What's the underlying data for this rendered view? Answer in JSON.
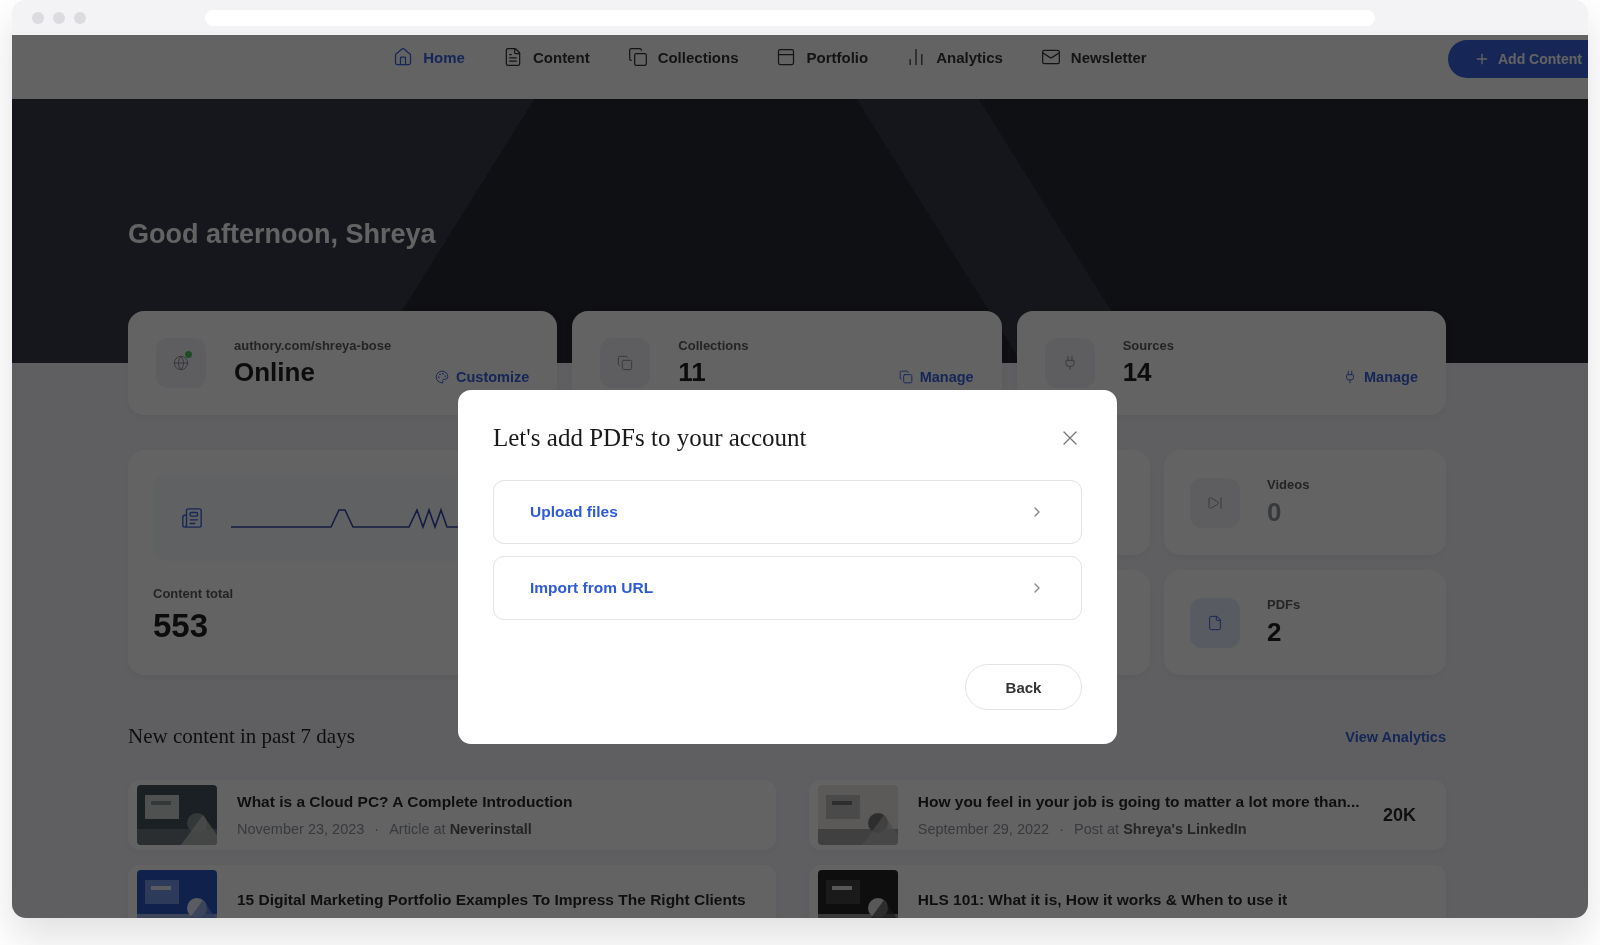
{
  "nav": {
    "items": [
      {
        "label": "Home",
        "kind": "home",
        "selected": true
      },
      {
        "label": "Content",
        "kind": "content",
        "selected": false
      },
      {
        "label": "Collections",
        "kind": "collections",
        "selected": false
      },
      {
        "label": "Portfolio",
        "kind": "portfolio",
        "selected": false
      },
      {
        "label": "Analytics",
        "kind": "analytics",
        "selected": false
      },
      {
        "label": "Newsletter",
        "kind": "newsletter",
        "selected": false
      }
    ],
    "action": "Add Content"
  },
  "hero": {
    "greeting": "Good afternoon, Shreya"
  },
  "stat_cards": [
    {
      "kind": "site",
      "label": "authory.com/shreya-bose",
      "value": "Online",
      "action": "Customize",
      "live": true
    },
    {
      "kind": "collections",
      "label": "Collections",
      "value": "11",
      "action": "Manage",
      "live": false
    },
    {
      "kind": "sources",
      "label": "Sources",
      "value": "14",
      "action": "Manage",
      "live": false
    }
  ],
  "content_total": {
    "label": "Content total",
    "value": "553"
  },
  "type_cards": [
    {
      "kind": "video",
      "label": "Videos",
      "value": "0",
      "selected": false
    },
    {
      "kind": "pdf",
      "label": "PDFs",
      "value": "2",
      "selected": true
    }
  ],
  "new_content": {
    "heading": "New content in past 7 days",
    "link": "View Analytics",
    "items": [
      {
        "title": "What is a Cloud PC? A Complete Introduction",
        "date": "November 23, 2023",
        "separator": "·",
        "source": "Article at **Neverinstall**"
      },
      {
        "title": "How you feel in your job is going to matter a lot more than...",
        "date": "September 29, 2022",
        "separator": "·",
        "source": "Post at **Shreya's LinkedIn**",
        "count": "20K"
      },
      {
        "title": "15 Digital Marketing Portfolio Examples To Impress The Right Clients"
      },
      {
        "title": "HLS 101: What it is, How it works & When to use it"
      }
    ]
  },
  "modal": {
    "title": "Let's add PDFs to your account",
    "options": [
      {
        "label": "Upload files"
      },
      {
        "label": "Import from URL"
      }
    ],
    "back": "Back"
  }
}
